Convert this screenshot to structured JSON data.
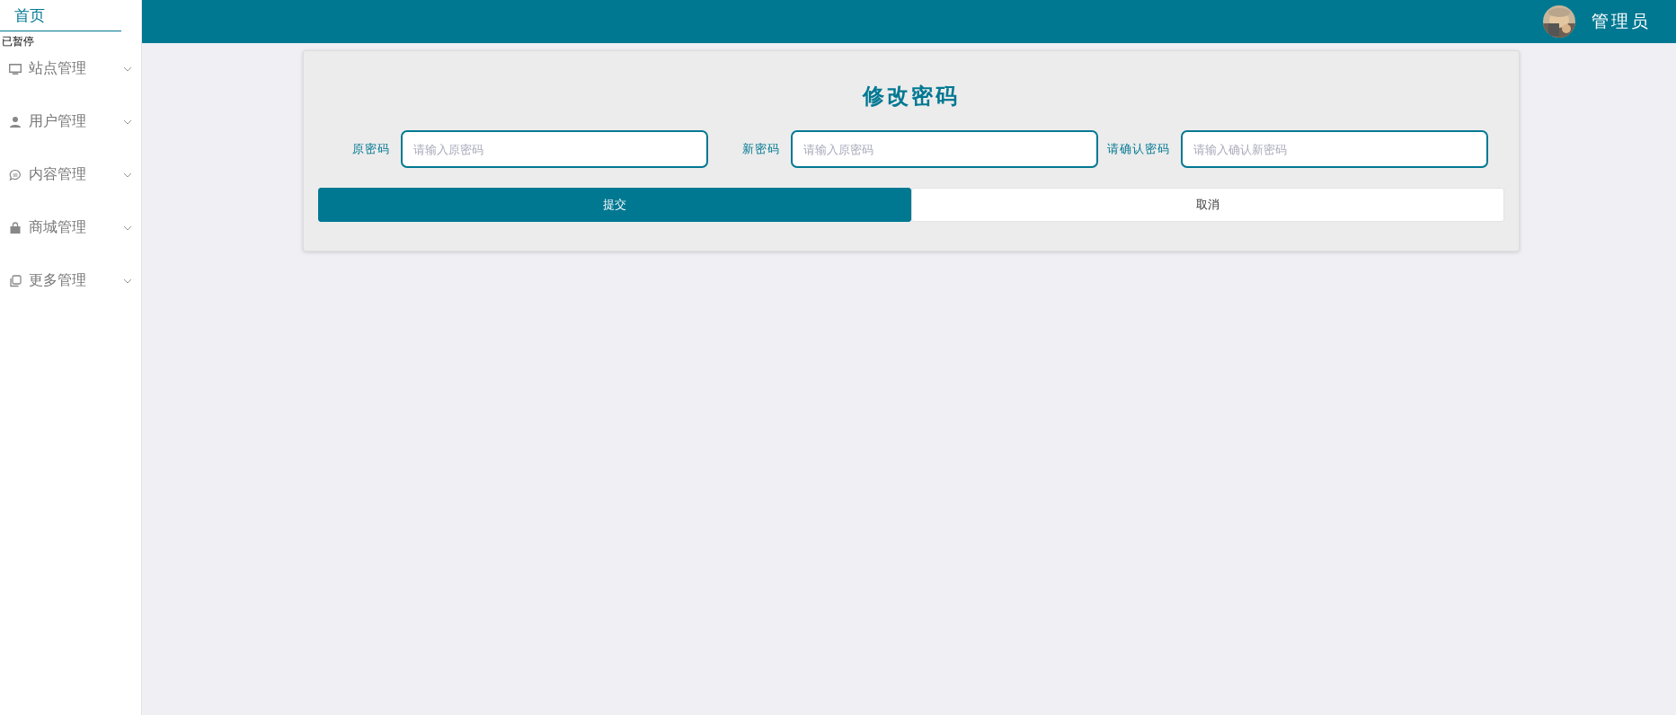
{
  "sidebar": {
    "home": "首页",
    "paused_overlay": "已暂停",
    "items": [
      {
        "label": "站点管理",
        "expanded": false
      },
      {
        "label": "用户管理",
        "expanded": false
      },
      {
        "label": "内容管理",
        "expanded": false
      },
      {
        "label": "商城管理",
        "expanded": false
      },
      {
        "label": "更多管理",
        "expanded": false
      }
    ]
  },
  "header": {
    "user": "管理员"
  },
  "form": {
    "title": "修改密码",
    "fields": [
      {
        "label": "原密码",
        "placeholder": "请输入原密码"
      },
      {
        "label": "新密码",
        "placeholder": "请输入原密码"
      },
      {
        "label": "请确认密码",
        "placeholder": "请输入确认新密码"
      }
    ],
    "buttons": [
      {
        "label": "提交",
        "kind": "primary"
      },
      {
        "label": "取消",
        "kind": "default"
      }
    ]
  }
}
